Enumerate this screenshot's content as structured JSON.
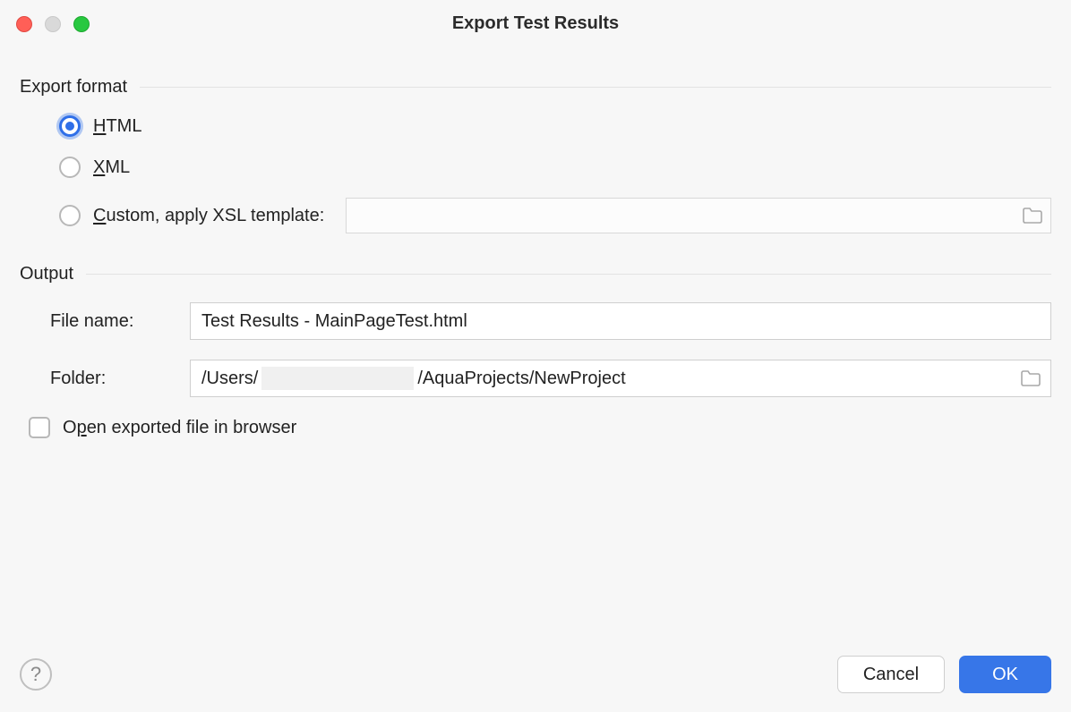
{
  "window": {
    "title": "Export Test Results"
  },
  "sections": {
    "export_format": {
      "title": "Export format",
      "options": {
        "html": {
          "prefix": "H",
          "rest": "TML",
          "selected": true
        },
        "xml": {
          "prefix": "X",
          "rest": "ML",
          "selected": false
        },
        "custom": {
          "prefix": "C",
          "rest": "ustom, apply XSL template:",
          "selected": false,
          "xsl_value": ""
        }
      }
    },
    "output": {
      "title": "Output",
      "file_name": {
        "label": "File name:",
        "value": "Test Results - MainPageTest.html"
      },
      "folder": {
        "label": "Folder:",
        "prefix": "/Users/",
        "suffix": "/AquaProjects/NewProject"
      }
    }
  },
  "open_in_browser": {
    "checked": false,
    "prefix": "O",
    "underlined": "p",
    "rest": "en exported file in browser"
  },
  "buttons": {
    "cancel": "Cancel",
    "ok": "OK",
    "help_glyph": "?"
  }
}
